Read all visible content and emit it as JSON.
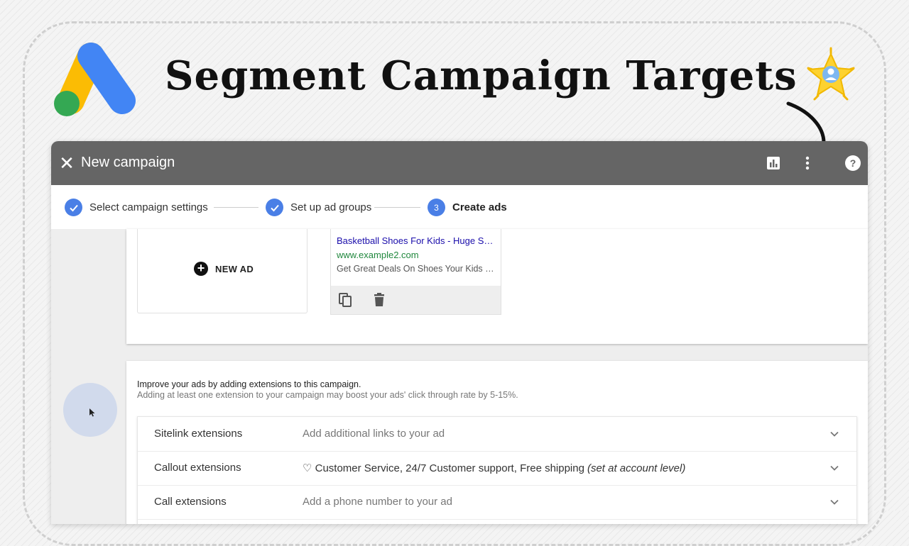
{
  "headline": "Segment Campaign Targets",
  "window": {
    "title": "New campaign",
    "icons": [
      "close-icon",
      "bar-chart-icon",
      "more-vert-icon",
      "help-icon"
    ]
  },
  "stepper": {
    "steps": [
      {
        "label": "Select campaign settings",
        "state": "done"
      },
      {
        "label": "Set up ad groups",
        "state": "done"
      },
      {
        "label": "Create ads",
        "state": "active",
        "number": "3"
      }
    ]
  },
  "ads": {
    "new_ad_label": "NEW AD",
    "preview": {
      "title": "Basketball Shoes For Kids - Huge Selection",
      "url": "www.example2.com",
      "description": "Get Great Deals On Shoes Your Kids Will Love"
    }
  },
  "extensions": {
    "heading": "Improve your ads by adding extensions to this campaign.",
    "subheading": "Adding at least one extension to your campaign may boost your ads' click through rate by 5-15%.",
    "rows": [
      {
        "name": "Sitelink extensions",
        "value": "Add additional links to your ad"
      },
      {
        "name": "Callout extensions",
        "value": "♡ Customer Service, 24/7 Customer support, Free shipping",
        "note": "(set at account level)"
      },
      {
        "name": "Call extensions",
        "value": "Add a phone number to your ad"
      }
    ]
  },
  "colors": {
    "titlebar": "#656565",
    "step_accent": "#4a7fe6",
    "ad_title": "#1a0dab",
    "ad_url": "#21883e"
  }
}
